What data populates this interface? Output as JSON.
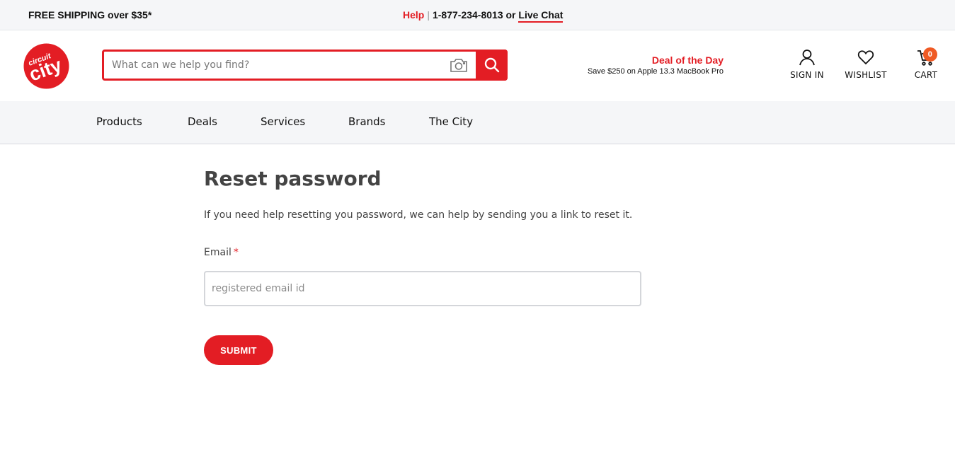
{
  "topbar": {
    "shipping": "FREE SHIPPING over $35*",
    "help": "Help",
    "separator": "|",
    "phone": "1-877-234-8013 or",
    "live_chat": "Live Chat"
  },
  "header": {
    "logo": {
      "line1": "circuit",
      "line2": "city"
    },
    "search": {
      "placeholder": "What can we help you find?",
      "value": ""
    },
    "deal": {
      "title": "Deal of the Day",
      "text": "Save $250 on Apple 13.3 MacBook Pro"
    },
    "sign_in": "SIGN IN",
    "wishlist": "WISHLIST",
    "cart": {
      "label": "CART",
      "count": "0"
    }
  },
  "nav": {
    "items": [
      {
        "label": "Products"
      },
      {
        "label": "Deals"
      },
      {
        "label": "Services"
      },
      {
        "label": "Brands"
      },
      {
        "label": "The City"
      }
    ]
  },
  "main": {
    "title": "Reset password",
    "description": "If you need help resetting you password, we can help by sending you a link to reset it.",
    "email_label": "Email",
    "required_mark": "*",
    "email_placeholder": "registered email id",
    "email_value": "",
    "submit_label": "SUBMIT"
  },
  "colors": {
    "brand_red": "#e31d24",
    "badge_orange": "#ef5a24",
    "bar_gray": "#f5f6f8"
  }
}
